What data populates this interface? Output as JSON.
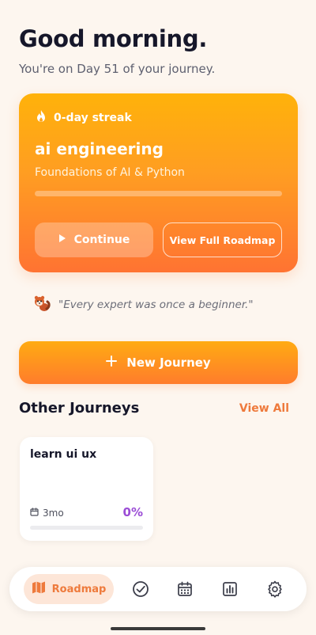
{
  "header": {
    "greeting": "Good morning.",
    "subtitle": "You're on Day 51 of your journey."
  },
  "hero": {
    "streak": "0-day streak",
    "title": "ai engineering",
    "subtitle": "Foundations of AI & Python",
    "progress_percent": 0,
    "continue_label": "Continue",
    "roadmap_label": "View Full Roadmap"
  },
  "quote": {
    "text": "\"Every expert was once a beginner.\"",
    "icon": "red-panda-icon"
  },
  "new_journey": {
    "label": "New Journey"
  },
  "other_journeys": {
    "title": "Other Journeys",
    "view_all": "View All",
    "items": [
      {
        "title": "learn ui ux",
        "duration": "3mo",
        "percent": "0%",
        "progress": 0
      }
    ]
  },
  "nav": {
    "active_label": "Roadmap",
    "icons": [
      "map-icon",
      "check-circle-icon",
      "calendar-icon",
      "chart-icon",
      "gear-icon"
    ]
  },
  "colors": {
    "background": "#fdf6ef",
    "accent": "#ee7a3c",
    "hero_top": "#ffb20a",
    "hero_bottom": "#ff7332",
    "purple": "#9b4dd6"
  }
}
